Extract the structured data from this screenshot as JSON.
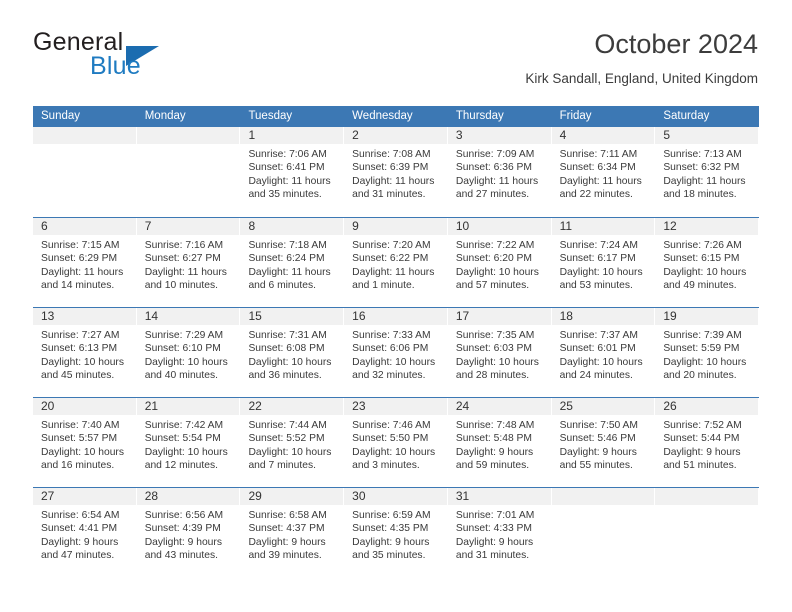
{
  "brand": {
    "name_top": "General",
    "name_bottom": "Blue",
    "triangle_icon": "triangle-icon",
    "accent_color": "#1b6cb0"
  },
  "header": {
    "title": "October 2024",
    "subtitle": "Kirk Sandall, England, United Kingdom"
  },
  "theme": {
    "header_blue": "#3c78b4",
    "day_band_gray": "#f1f1f1",
    "text": "#3a3a3a"
  },
  "calendar": {
    "weekdays": [
      "Sunday",
      "Monday",
      "Tuesday",
      "Wednesday",
      "Thursday",
      "Friday",
      "Saturday"
    ],
    "weeks": [
      [
        {
          "empty": true
        },
        {
          "empty": true
        },
        {
          "day": "1",
          "sunrise": "Sunrise: 7:06 AM",
          "sunset": "Sunset: 6:41 PM",
          "daylight1": "Daylight: 11 hours",
          "daylight2": "and 35 minutes."
        },
        {
          "day": "2",
          "sunrise": "Sunrise: 7:08 AM",
          "sunset": "Sunset: 6:39 PM",
          "daylight1": "Daylight: 11 hours",
          "daylight2": "and 31 minutes."
        },
        {
          "day": "3",
          "sunrise": "Sunrise: 7:09 AM",
          "sunset": "Sunset: 6:36 PM",
          "daylight1": "Daylight: 11 hours",
          "daylight2": "and 27 minutes."
        },
        {
          "day": "4",
          "sunrise": "Sunrise: 7:11 AM",
          "sunset": "Sunset: 6:34 PM",
          "daylight1": "Daylight: 11 hours",
          "daylight2": "and 22 minutes."
        },
        {
          "day": "5",
          "sunrise": "Sunrise: 7:13 AM",
          "sunset": "Sunset: 6:32 PM",
          "daylight1": "Daylight: 11 hours",
          "daylight2": "and 18 minutes."
        }
      ],
      [
        {
          "day": "6",
          "sunrise": "Sunrise: 7:15 AM",
          "sunset": "Sunset: 6:29 PM",
          "daylight1": "Daylight: 11 hours",
          "daylight2": "and 14 minutes."
        },
        {
          "day": "7",
          "sunrise": "Sunrise: 7:16 AM",
          "sunset": "Sunset: 6:27 PM",
          "daylight1": "Daylight: 11 hours",
          "daylight2": "and 10 minutes."
        },
        {
          "day": "8",
          "sunrise": "Sunrise: 7:18 AM",
          "sunset": "Sunset: 6:24 PM",
          "daylight1": "Daylight: 11 hours",
          "daylight2": "and 6 minutes."
        },
        {
          "day": "9",
          "sunrise": "Sunrise: 7:20 AM",
          "sunset": "Sunset: 6:22 PM",
          "daylight1": "Daylight: 11 hours",
          "daylight2": "and 1 minute."
        },
        {
          "day": "10",
          "sunrise": "Sunrise: 7:22 AM",
          "sunset": "Sunset: 6:20 PM",
          "daylight1": "Daylight: 10 hours",
          "daylight2": "and 57 minutes."
        },
        {
          "day": "11",
          "sunrise": "Sunrise: 7:24 AM",
          "sunset": "Sunset: 6:17 PM",
          "daylight1": "Daylight: 10 hours",
          "daylight2": "and 53 minutes."
        },
        {
          "day": "12",
          "sunrise": "Sunrise: 7:26 AM",
          "sunset": "Sunset: 6:15 PM",
          "daylight1": "Daylight: 10 hours",
          "daylight2": "and 49 minutes."
        }
      ],
      [
        {
          "day": "13",
          "sunrise": "Sunrise: 7:27 AM",
          "sunset": "Sunset: 6:13 PM",
          "daylight1": "Daylight: 10 hours",
          "daylight2": "and 45 minutes."
        },
        {
          "day": "14",
          "sunrise": "Sunrise: 7:29 AM",
          "sunset": "Sunset: 6:10 PM",
          "daylight1": "Daylight: 10 hours",
          "daylight2": "and 40 minutes."
        },
        {
          "day": "15",
          "sunrise": "Sunrise: 7:31 AM",
          "sunset": "Sunset: 6:08 PM",
          "daylight1": "Daylight: 10 hours",
          "daylight2": "and 36 minutes."
        },
        {
          "day": "16",
          "sunrise": "Sunrise: 7:33 AM",
          "sunset": "Sunset: 6:06 PM",
          "daylight1": "Daylight: 10 hours",
          "daylight2": "and 32 minutes."
        },
        {
          "day": "17",
          "sunrise": "Sunrise: 7:35 AM",
          "sunset": "Sunset: 6:03 PM",
          "daylight1": "Daylight: 10 hours",
          "daylight2": "and 28 minutes."
        },
        {
          "day": "18",
          "sunrise": "Sunrise: 7:37 AM",
          "sunset": "Sunset: 6:01 PM",
          "daylight1": "Daylight: 10 hours",
          "daylight2": "and 24 minutes."
        },
        {
          "day": "19",
          "sunrise": "Sunrise: 7:39 AM",
          "sunset": "Sunset: 5:59 PM",
          "daylight1": "Daylight: 10 hours",
          "daylight2": "and 20 minutes."
        }
      ],
      [
        {
          "day": "20",
          "sunrise": "Sunrise: 7:40 AM",
          "sunset": "Sunset: 5:57 PM",
          "daylight1": "Daylight: 10 hours",
          "daylight2": "and 16 minutes."
        },
        {
          "day": "21",
          "sunrise": "Sunrise: 7:42 AM",
          "sunset": "Sunset: 5:54 PM",
          "daylight1": "Daylight: 10 hours",
          "daylight2": "and 12 minutes."
        },
        {
          "day": "22",
          "sunrise": "Sunrise: 7:44 AM",
          "sunset": "Sunset: 5:52 PM",
          "daylight1": "Daylight: 10 hours",
          "daylight2": "and 7 minutes."
        },
        {
          "day": "23",
          "sunrise": "Sunrise: 7:46 AM",
          "sunset": "Sunset: 5:50 PM",
          "daylight1": "Daylight: 10 hours",
          "daylight2": "and 3 minutes."
        },
        {
          "day": "24",
          "sunrise": "Sunrise: 7:48 AM",
          "sunset": "Sunset: 5:48 PM",
          "daylight1": "Daylight: 9 hours",
          "daylight2": "and 59 minutes."
        },
        {
          "day": "25",
          "sunrise": "Sunrise: 7:50 AM",
          "sunset": "Sunset: 5:46 PM",
          "daylight1": "Daylight: 9 hours",
          "daylight2": "and 55 minutes."
        },
        {
          "day": "26",
          "sunrise": "Sunrise: 7:52 AM",
          "sunset": "Sunset: 5:44 PM",
          "daylight1": "Daylight: 9 hours",
          "daylight2": "and 51 minutes."
        }
      ],
      [
        {
          "day": "27",
          "sunrise": "Sunrise: 6:54 AM",
          "sunset": "Sunset: 4:41 PM",
          "daylight1": "Daylight: 9 hours",
          "daylight2": "and 47 minutes."
        },
        {
          "day": "28",
          "sunrise": "Sunrise: 6:56 AM",
          "sunset": "Sunset: 4:39 PM",
          "daylight1": "Daylight: 9 hours",
          "daylight2": "and 43 minutes."
        },
        {
          "day": "29",
          "sunrise": "Sunrise: 6:58 AM",
          "sunset": "Sunset: 4:37 PM",
          "daylight1": "Daylight: 9 hours",
          "daylight2": "and 39 minutes."
        },
        {
          "day": "30",
          "sunrise": "Sunrise: 6:59 AM",
          "sunset": "Sunset: 4:35 PM",
          "daylight1": "Daylight: 9 hours",
          "daylight2": "and 35 minutes."
        },
        {
          "day": "31",
          "sunrise": "Sunrise: 7:01 AM",
          "sunset": "Sunset: 4:33 PM",
          "daylight1": "Daylight: 9 hours",
          "daylight2": "and 31 minutes."
        },
        {
          "empty": true
        },
        {
          "empty": true
        }
      ]
    ]
  }
}
